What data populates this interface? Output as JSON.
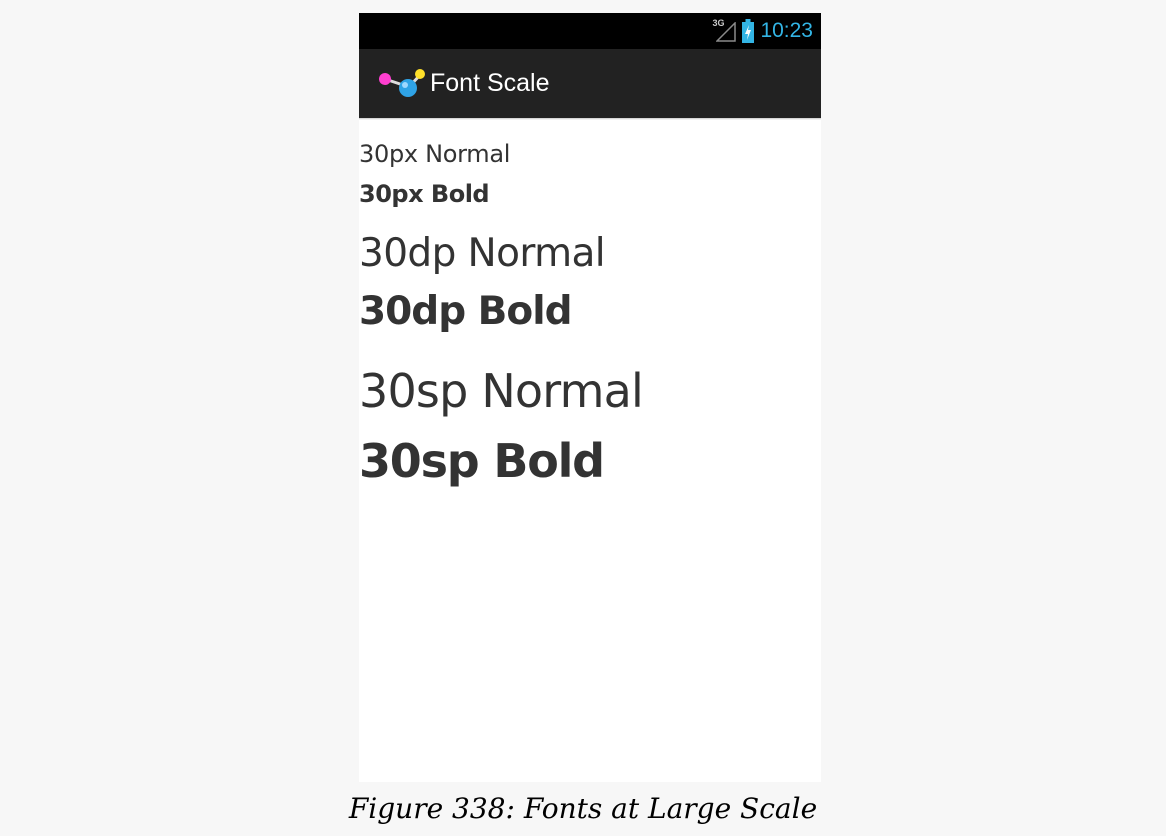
{
  "status_bar": {
    "network_label": "3G",
    "clock": "10:23",
    "clock_color": "#33b5e5",
    "icons": [
      "signal-icon",
      "battery-charging-icon"
    ]
  },
  "action_bar": {
    "title": "Font Scale",
    "icon": "app-molecule-icon",
    "background": "#222222"
  },
  "samples": [
    {
      "label": "30px Normal"
    },
    {
      "label": "30px Bold"
    },
    {
      "label": "30dp Normal"
    },
    {
      "label": "30dp Bold"
    },
    {
      "label": "30sp Normal"
    },
    {
      "label": "30sp Bold"
    }
  ],
  "caption": "Figure 338: Fonts at Large Scale"
}
